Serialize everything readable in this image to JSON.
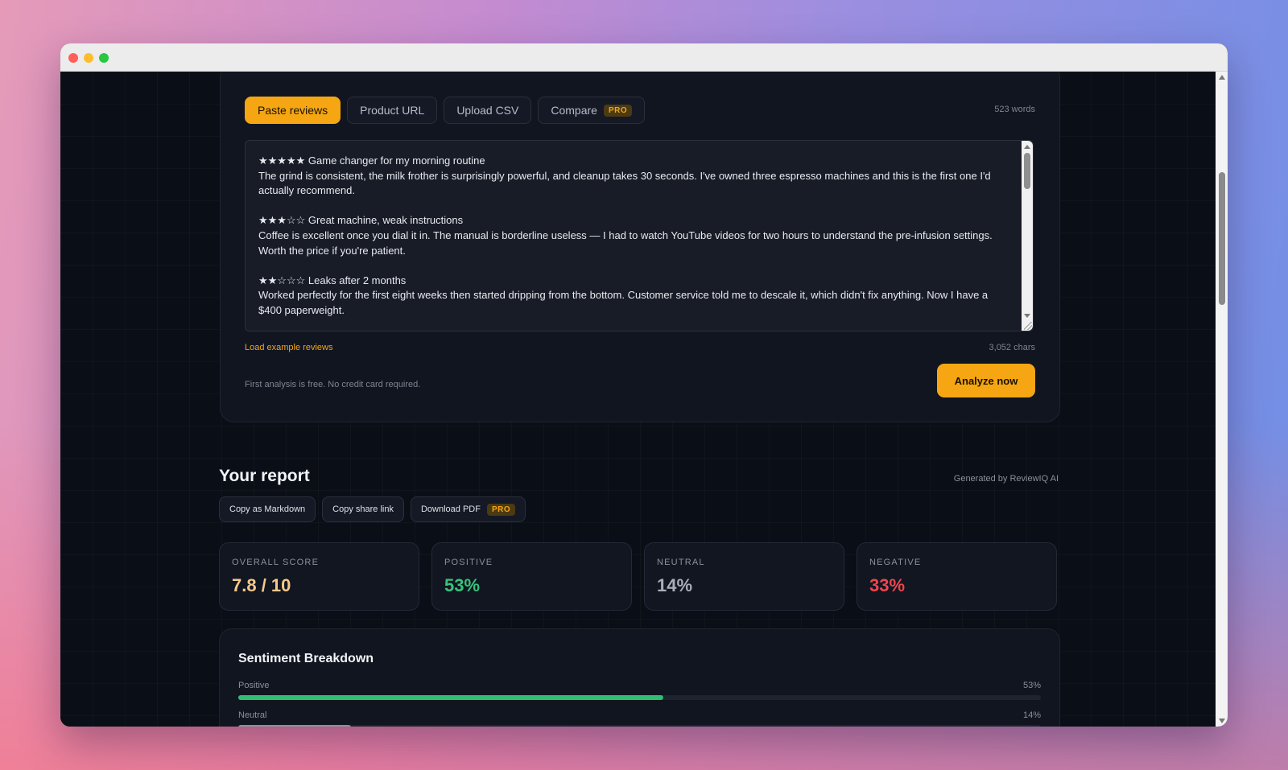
{
  "tabs": [
    {
      "label": "Paste reviews",
      "active": true
    },
    {
      "label": "Product URL",
      "active": false
    },
    {
      "label": "Upload CSV",
      "active": false
    },
    {
      "label": "Compare",
      "active": false,
      "badge": "PRO"
    }
  ],
  "word_count": "523 words",
  "reviews": [
    {
      "stars": "★★★★★",
      "title": "Game changer for my morning routine",
      "body": "The grind is consistent, the milk frother is surprisingly powerful, and cleanup takes 30 seconds. I've owned three espresso machines and this is the first one I'd actually recommend."
    },
    {
      "stars": "★★★☆☆",
      "title": "Great machine, weak instructions",
      "body": "Coffee is excellent once you dial it in. The manual is borderline useless — I had to watch YouTube videos for two hours to understand the pre-infusion settings. Worth the price if you're patient."
    },
    {
      "stars": "★★☆☆☆",
      "title": "Leaks after 2 months",
      "body": "Worked perfectly for the first eight weeks then started dripping from the bottom. Customer service told me to descale it, which didn't fix anything. Now I have a $400 paperweight."
    }
  ],
  "load_example": "Load example reviews",
  "char_count": "3,052 chars",
  "free_note": "First analysis is free. No credit card required.",
  "analyze_label": "Analyze now",
  "report": {
    "title": "Your report",
    "generated_by": "Generated by ReviewIQ AI",
    "actions": [
      {
        "label": "Copy as Markdown"
      },
      {
        "label": "Copy share link"
      },
      {
        "label": "Download PDF",
        "badge": "PRO"
      }
    ],
    "stats": [
      {
        "label": "OVERALL SCORE",
        "value": "7.8 / 10"
      },
      {
        "label": "POSITIVE",
        "value": "53%"
      },
      {
        "label": "NEUTRAL",
        "value": "14%"
      },
      {
        "label": "NEGATIVE",
        "value": "33%"
      }
    ],
    "sentiment": {
      "title": "Sentiment Breakdown",
      "rows": [
        {
          "label": "Positive",
          "pct": "53%",
          "value": 53,
          "color": "#2fbf71"
        },
        {
          "label": "Neutral",
          "pct": "14%",
          "value": 14,
          "color": "#8b909c"
        }
      ]
    }
  },
  "colors": {
    "accent": "#f5a612",
    "positive": "#37c47b",
    "negative": "#f0444d"
  }
}
